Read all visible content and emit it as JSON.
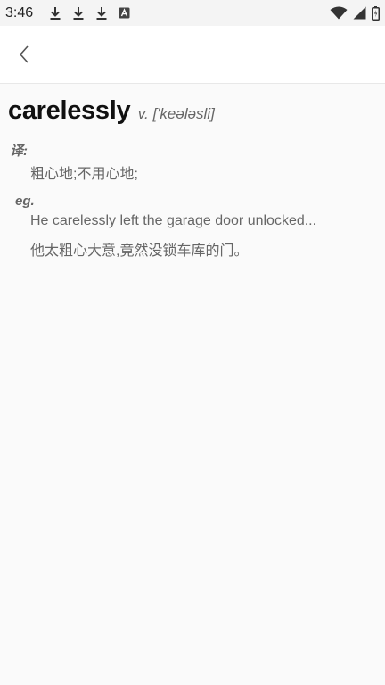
{
  "status": {
    "time": "3:46",
    "icons_left": [
      "download-icon",
      "download-icon",
      "download-icon",
      "font-a-icon"
    ],
    "icons_right": [
      "wifi-icon",
      "signal-icon",
      "battery-icon"
    ]
  },
  "header": {
    "back_icon": "chevron-left-icon"
  },
  "entry": {
    "word": "carelessly",
    "pos_phonetic": "v. ['keələsli]",
    "translation_label": "译:",
    "translation": "粗心地;不用心地;",
    "example_label": "eg.",
    "example_en": "He carelessly left the garage door unlocked...",
    "example_zh": "他太粗心大意,竟然没锁车库的门。"
  },
  "colors": {
    "background": "#fafafa",
    "header_bg": "#ffffff",
    "status_bg": "#f4f4f4",
    "word_text": "#111111",
    "secondary_text": "#666666"
  }
}
